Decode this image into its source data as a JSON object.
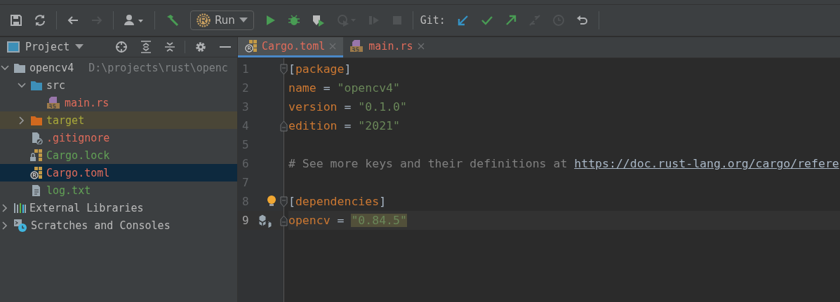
{
  "toolbar": {
    "run_label": "Run",
    "git_label": "Git:",
    "buttons": [
      {
        "kind": "save",
        "disabled": false
      },
      {
        "kind": "sync",
        "disabled": false
      },
      {
        "kind": "sep"
      },
      {
        "kind": "back",
        "disabled": false
      },
      {
        "kind": "forward",
        "disabled": true
      },
      {
        "kind": "sep"
      },
      {
        "kind": "user",
        "disabled": false
      },
      {
        "kind": "sep"
      },
      {
        "kind": "build",
        "disabled": false
      },
      {
        "kind": "run-config"
      },
      {
        "kind": "play",
        "disabled": false
      },
      {
        "kind": "debug",
        "disabled": false
      },
      {
        "kind": "coverage",
        "disabled": false
      },
      {
        "kind": "profile",
        "disabled": true
      },
      {
        "kind": "attach",
        "disabled": true
      },
      {
        "kind": "stop",
        "disabled": true
      },
      {
        "kind": "sep"
      },
      {
        "kind": "git-label"
      },
      {
        "kind": "git-update",
        "disabled": false
      },
      {
        "kind": "git-commit",
        "disabled": false
      },
      {
        "kind": "git-push",
        "disabled": false
      },
      {
        "kind": "git-merge",
        "disabled": true
      },
      {
        "kind": "git-history",
        "disabled": true
      },
      {
        "kind": "git-rollback",
        "disabled": false
      },
      {
        "kind": "sep"
      }
    ]
  },
  "project": {
    "title": "Project",
    "tree": [
      {
        "label": "opencv4",
        "path": "D:\\projects\\rust\\openc",
        "kind": "project-folder",
        "color": "#bbbbbb",
        "expanded": true,
        "selected": false,
        "excluded": false,
        "children": [
          {
            "label": "src",
            "kind": "source-folder",
            "color": "#bbbbbb",
            "expanded": true,
            "selected": false,
            "excluded": false,
            "children": [
              {
                "label": "main.rs",
                "kind": "rust-file",
                "color": "#e06c5b",
                "selected": false,
                "excluded": false
              }
            ]
          },
          {
            "label": "target",
            "kind": "excluded-folder",
            "color": "#a9a93a",
            "expanded": false,
            "selected": false,
            "excluded": true
          },
          {
            "label": ".gitignore",
            "kind": "ignore-file",
            "color": "#e06c5b",
            "selected": false,
            "excluded": false
          },
          {
            "label": "Cargo.lock",
            "kind": "lock-file",
            "color": "#62a156",
            "selected": false,
            "excluded": false
          },
          {
            "label": "Cargo.toml",
            "kind": "cargo-file",
            "color": "#e06c5b",
            "selected": true,
            "excluded": false
          },
          {
            "label": "log.txt",
            "kind": "text-file",
            "color": "#62a156",
            "selected": false,
            "excluded": false
          }
        ]
      },
      {
        "label": "External Libraries",
        "kind": "libraries",
        "color": "#bbbbbb",
        "expanded": false,
        "selected": false,
        "excluded": false
      },
      {
        "label": "Scratches and Consoles",
        "kind": "scratches",
        "color": "#bbbbbb",
        "expanded": false,
        "selected": false,
        "excluded": false
      }
    ]
  },
  "editor": {
    "tabs": [
      {
        "label": "Cargo.toml",
        "kind": "cargo-file",
        "color": "#e06c5b",
        "selected": true
      },
      {
        "label": "main.rs",
        "kind": "rust-file",
        "color": "#e06c5b",
        "selected": false
      }
    ],
    "lines": [
      {
        "number": "1",
        "fold_start": true,
        "fold_end": false,
        "current": false,
        "crate": false,
        "bulb": false,
        "tokens": [
          {
            "kind": "bracket",
            "text": "["
          },
          {
            "kind": "section",
            "text": "package"
          },
          {
            "kind": "bracket",
            "text": "]"
          }
        ]
      },
      {
        "number": "2",
        "fold_start": false,
        "fold_end": false,
        "current": false,
        "crate": false,
        "bulb": false,
        "tokens": [
          {
            "kind": "key",
            "text": "name"
          },
          {
            "kind": "op",
            "text": " = "
          },
          {
            "kind": "string",
            "text": "\"opencv4\""
          }
        ]
      },
      {
        "number": "3",
        "fold_start": false,
        "fold_end": false,
        "current": false,
        "crate": false,
        "bulb": false,
        "tokens": [
          {
            "kind": "key",
            "text": "version"
          },
          {
            "kind": "op",
            "text": " = "
          },
          {
            "kind": "string",
            "text": "\"0.1.0\""
          }
        ]
      },
      {
        "number": "4",
        "fold_start": false,
        "fold_end": true,
        "current": false,
        "crate": false,
        "bulb": false,
        "tokens": [
          {
            "kind": "key",
            "text": "edition"
          },
          {
            "kind": "op",
            "text": " = "
          },
          {
            "kind": "string",
            "text": "\"2021\""
          }
        ]
      },
      {
        "number": "5",
        "fold_start": false,
        "fold_end": false,
        "current": false,
        "crate": false,
        "bulb": false
      },
      {
        "number": "6",
        "fold_start": false,
        "fold_end": false,
        "current": false,
        "crate": false,
        "bulb": false,
        "tokens": [
          {
            "kind": "comment",
            "text": "# See more keys and their definitions at "
          },
          {
            "kind": "link",
            "text": "https://doc.rust-lang.org/cargo/refere"
          }
        ]
      },
      {
        "number": "7",
        "fold_start": false,
        "fold_end": false,
        "current": false,
        "crate": false,
        "bulb": false
      },
      {
        "number": "8",
        "fold_start": true,
        "fold_end": false,
        "current": false,
        "crate": false,
        "bulb": true,
        "tokens": [
          {
            "kind": "bracket",
            "text": "["
          },
          {
            "kind": "section",
            "text": "dependencies"
          },
          {
            "kind": "bracket",
            "text": "]"
          }
        ]
      },
      {
        "number": "9",
        "fold_start": false,
        "fold_end": true,
        "current": true,
        "crate": true,
        "bulb": false,
        "tokens": [
          {
            "kind": "key",
            "text": "opencv"
          },
          {
            "kind": "op",
            "text": " = "
          },
          {
            "kind": "string-highlighted",
            "text": "\"0.84.5\""
          }
        ]
      }
    ]
  }
}
